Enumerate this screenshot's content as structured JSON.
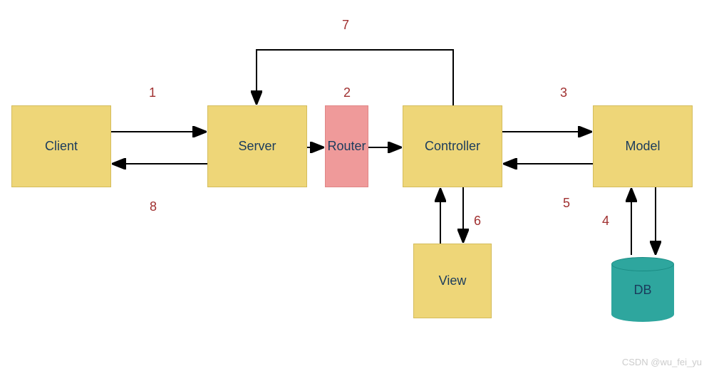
{
  "nodes": {
    "client": "Client",
    "server": "Server",
    "router": "Router",
    "controller": "Controller",
    "model": "Model",
    "view": "View",
    "db": "DB"
  },
  "labels": {
    "n1": "1",
    "n2": "2",
    "n3": "3",
    "n4": "4",
    "n5": "5",
    "n6": "6",
    "n7": "7",
    "n8": "8"
  },
  "watermark": "CSDN @wu_fei_yu",
  "colors": {
    "yellow": "#eed678",
    "pink": "#ef9a9a",
    "teal": "#2ea69e",
    "text": "#1a3b5c",
    "num": "#a03030"
  }
}
